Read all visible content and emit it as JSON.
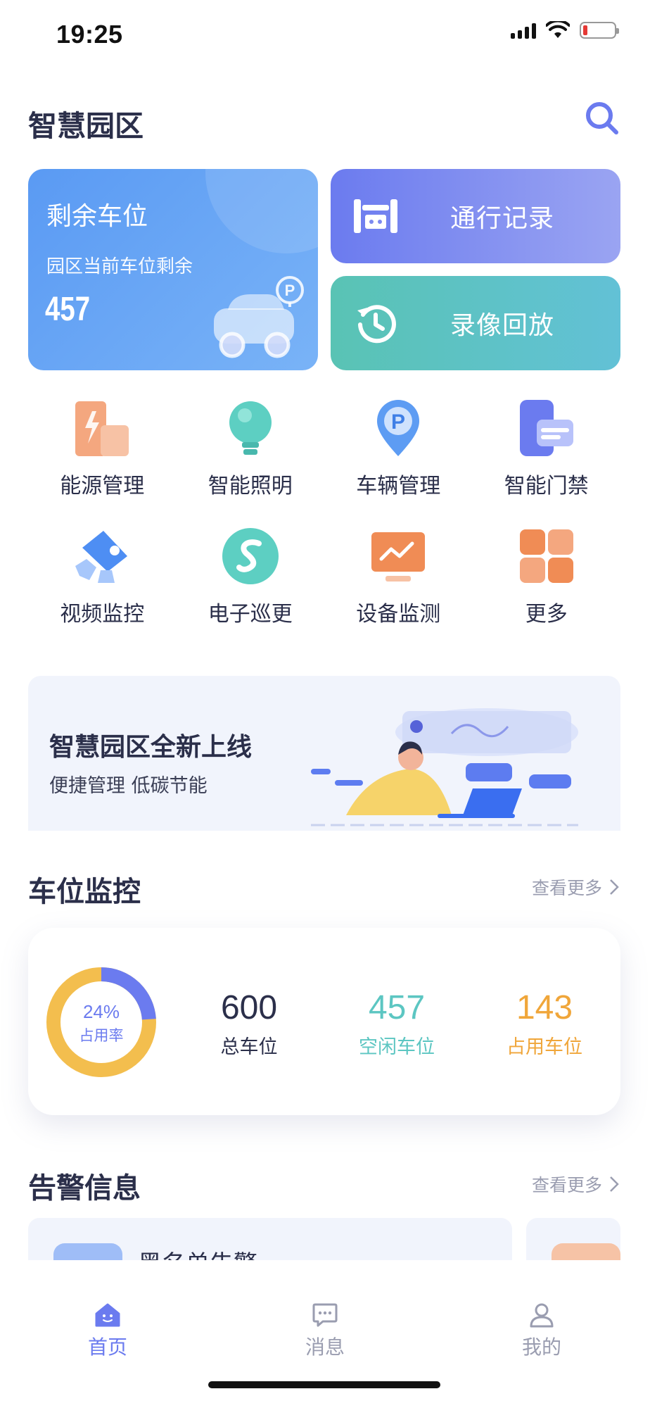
{
  "status_bar": {
    "time": "19:25"
  },
  "header": {
    "title": "智慧园区"
  },
  "parking_card": {
    "title": "剩余车位",
    "subtitle": "园区当前车位剩余",
    "value": "457"
  },
  "actions": [
    {
      "label": "通行记录",
      "icon": "gate-icon"
    },
    {
      "label": "录像回放",
      "icon": "history-icon"
    }
  ],
  "functions": [
    {
      "label": "能源管理",
      "icon": "energy-icon"
    },
    {
      "label": "智能照明",
      "icon": "bulb-icon"
    },
    {
      "label": "车辆管理",
      "icon": "parking-pin-icon"
    },
    {
      "label": "智能门禁",
      "icon": "access-card-icon"
    },
    {
      "label": "视频监控",
      "icon": "camera-icon"
    },
    {
      "label": "电子巡更",
      "icon": "patrol-icon"
    },
    {
      "label": "设备监测",
      "icon": "monitor-icon"
    },
    {
      "label": "更多",
      "icon": "grid-more-icon"
    }
  ],
  "banner": {
    "title": "智慧园区全新上线",
    "subtitle": "便捷管理 低碳节能"
  },
  "parking_monitor": {
    "section_title": "车位监控",
    "more_label": "查看更多",
    "rate_value": "24%",
    "rate_label": "占用率",
    "rate_fraction": 0.24,
    "total": {
      "value": "600",
      "label": "总车位"
    },
    "free": {
      "value": "457",
      "label": "空闲车位"
    },
    "occupied": {
      "value": "143",
      "label": "占用车位"
    },
    "colors": {
      "free": "#f3be4e",
      "occupied": "#6b7bef",
      "free_text": "#5cc6c2",
      "occupied_text": "#f0a63a"
    }
  },
  "alarms": {
    "section_title": "告警信息",
    "more_label": "查看更多",
    "items": [
      {
        "title": "黑名单告警"
      }
    ]
  },
  "bottom_nav": [
    {
      "label": "首页",
      "icon": "home-icon",
      "active": true
    },
    {
      "label": "消息",
      "icon": "message-icon",
      "active": false
    },
    {
      "label": "我的",
      "icon": "user-icon",
      "active": false
    }
  ],
  "colors": {
    "accent": "#6b7bef",
    "text": "#2b2f4a",
    "muted": "#9a9db0"
  }
}
